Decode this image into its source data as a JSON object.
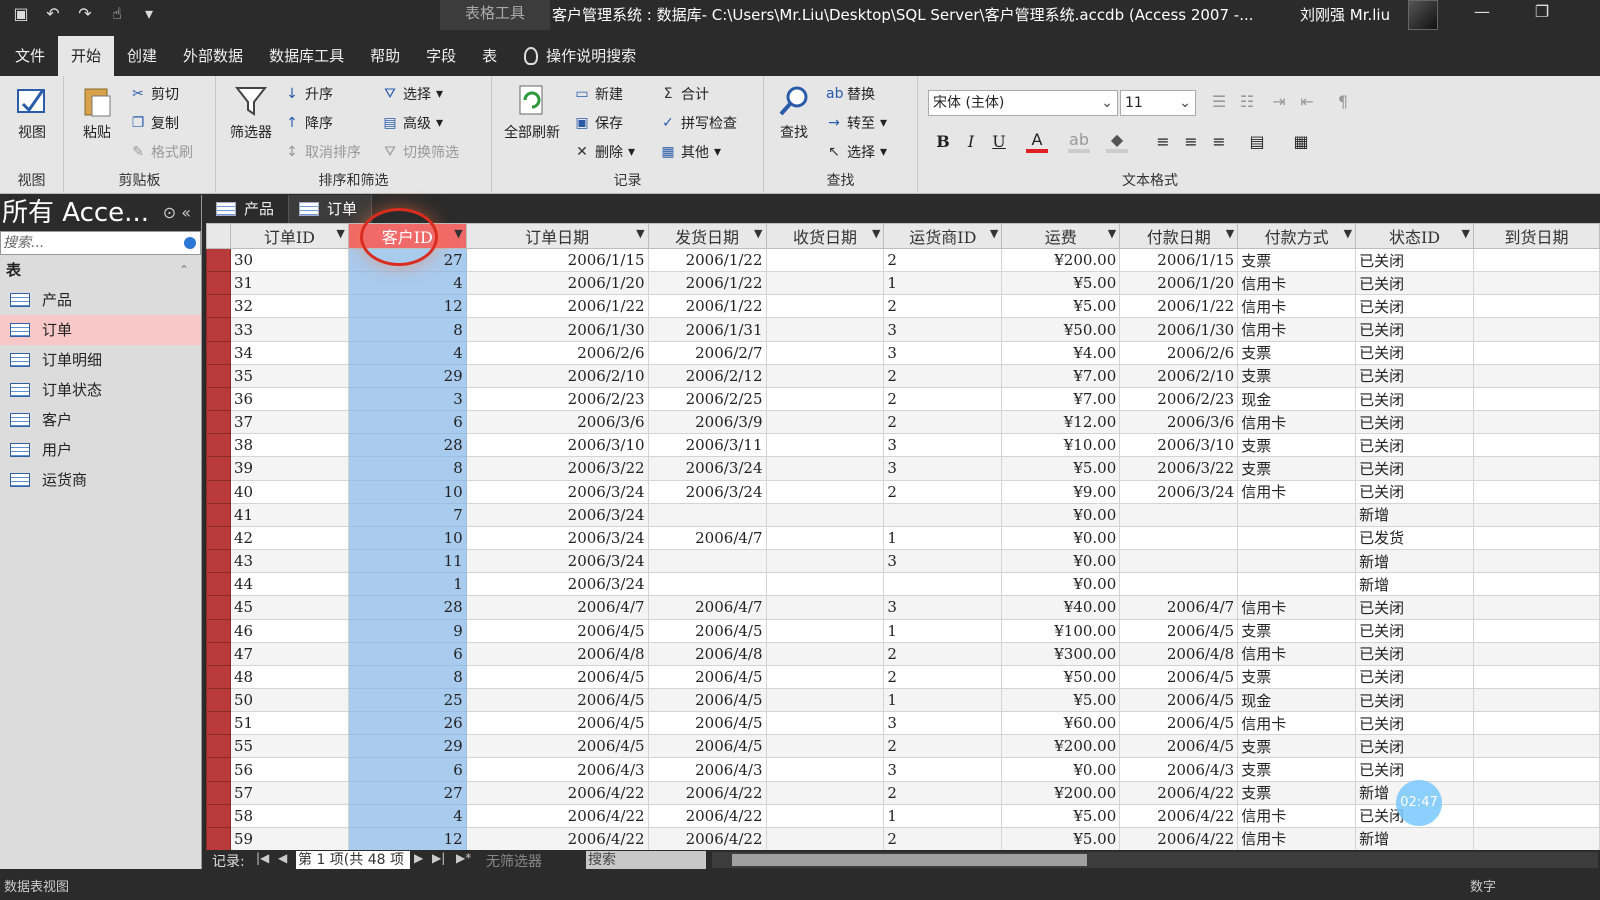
{
  "titlebar": {
    "context_tab": "表格工具",
    "title": "客户管理系统 : 数据库- C:\\Users\\Mr.Liu\\Desktop\\SQL Server\\客户管理系统.accdb (Access 2007 -...",
    "user": "刘刚强 Mr.liu"
  },
  "tabs": [
    "文件",
    "开始",
    "创建",
    "外部数据",
    "数据库工具",
    "帮助",
    "字段",
    "表"
  ],
  "tell_me": "操作说明搜索",
  "ribbon": {
    "view": {
      "label": "视图",
      "group": "视图"
    },
    "clipboard": {
      "paste": "粘贴",
      "cut": "剪切",
      "copy": "复制",
      "format_painter": "格式刷",
      "group": "剪贴板"
    },
    "sort_filter": {
      "filter": "筛选器",
      "asc": "升序",
      "desc": "降序",
      "remove_sort": "取消排序",
      "selection": "选择",
      "advanced": "高级",
      "toggle_filter": "切换筛选",
      "group": "排序和筛选"
    },
    "records": {
      "refresh": "全部刷新",
      "new": "新建",
      "save": "保存",
      "delete": "删除",
      "totals": "合计",
      "spelling": "拼写检查",
      "more": "其他",
      "group": "记录"
    },
    "find": {
      "find": "查找",
      "replace": "替换",
      "goto": "转至",
      "select": "选择",
      "group": "查找"
    },
    "text_format": {
      "font": "宋体 (主体)",
      "size": "11",
      "group": "文本格式"
    }
  },
  "nav": {
    "header": "所有 Acce...",
    "search_placeholder": "搜索...",
    "section": "表",
    "items": [
      "产品",
      "订单",
      "订单明细",
      "订单状态",
      "客户",
      "用户",
      "运货商"
    ],
    "active_index": 1
  },
  "doc_tabs": [
    "产品",
    "订单"
  ],
  "grid": {
    "columns": [
      "订单ID",
      "客户ID",
      "订单日期",
      "发货日期",
      "收货日期",
      "运货商ID",
      "运费",
      "付款日期",
      "付款方式",
      "状态ID",
      "到货日期"
    ],
    "selected_column": 1,
    "rows": [
      [
        "30",
        "27",
        "2006/1/15",
        "2006/1/22",
        "",
        "2",
        "¥200.00",
        "2006/1/15",
        "支票",
        "已关闭",
        ""
      ],
      [
        "31",
        "4",
        "2006/1/20",
        "2006/1/22",
        "",
        "1",
        "¥5.00",
        "2006/1/20",
        "信用卡",
        "已关闭",
        ""
      ],
      [
        "32",
        "12",
        "2006/1/22",
        "2006/1/22",
        "",
        "2",
        "¥5.00",
        "2006/1/22",
        "信用卡",
        "已关闭",
        ""
      ],
      [
        "33",
        "8",
        "2006/1/30",
        "2006/1/31",
        "",
        "3",
        "¥50.00",
        "2006/1/30",
        "信用卡",
        "已关闭",
        ""
      ],
      [
        "34",
        "4",
        "2006/2/6",
        "2006/2/7",
        "",
        "3",
        "¥4.00",
        "2006/2/6",
        "支票",
        "已关闭",
        ""
      ],
      [
        "35",
        "29",
        "2006/2/10",
        "2006/2/12",
        "",
        "2",
        "¥7.00",
        "2006/2/10",
        "支票",
        "已关闭",
        ""
      ],
      [
        "36",
        "3",
        "2006/2/23",
        "2006/2/25",
        "",
        "2",
        "¥7.00",
        "2006/2/23",
        "现金",
        "已关闭",
        ""
      ],
      [
        "37",
        "6",
        "2006/3/6",
        "2006/3/9",
        "",
        "2",
        "¥12.00",
        "2006/3/6",
        "信用卡",
        "已关闭",
        ""
      ],
      [
        "38",
        "28",
        "2006/3/10",
        "2006/3/11",
        "",
        "3",
        "¥10.00",
        "2006/3/10",
        "支票",
        "已关闭",
        ""
      ],
      [
        "39",
        "8",
        "2006/3/22",
        "2006/3/24",
        "",
        "3",
        "¥5.00",
        "2006/3/22",
        "支票",
        "已关闭",
        ""
      ],
      [
        "40",
        "10",
        "2006/3/24",
        "2006/3/24",
        "",
        "2",
        "¥9.00",
        "2006/3/24",
        "信用卡",
        "已关闭",
        ""
      ],
      [
        "41",
        "7",
        "2006/3/24",
        "",
        "",
        "",
        "¥0.00",
        "",
        "",
        "新增",
        ""
      ],
      [
        "42",
        "10",
        "2006/3/24",
        "2006/4/7",
        "",
        "1",
        "¥0.00",
        "",
        "",
        "已发货",
        ""
      ],
      [
        "43",
        "11",
        "2006/3/24",
        "",
        "",
        "3",
        "¥0.00",
        "",
        "",
        "新增",
        ""
      ],
      [
        "44",
        "1",
        "2006/3/24",
        "",
        "",
        "",
        "¥0.00",
        "",
        "",
        "新增",
        ""
      ],
      [
        "45",
        "28",
        "2006/4/7",
        "2006/4/7",
        "",
        "3",
        "¥40.00",
        "2006/4/7",
        "信用卡",
        "已关闭",
        ""
      ],
      [
        "46",
        "9",
        "2006/4/5",
        "2006/4/5",
        "",
        "1",
        "¥100.00",
        "2006/4/5",
        "支票",
        "已关闭",
        ""
      ],
      [
        "47",
        "6",
        "2006/4/8",
        "2006/4/8",
        "",
        "2",
        "¥300.00",
        "2006/4/8",
        "信用卡",
        "已关闭",
        ""
      ],
      [
        "48",
        "8",
        "2006/4/5",
        "2006/4/5",
        "",
        "2",
        "¥50.00",
        "2006/4/5",
        "支票",
        "已关闭",
        ""
      ],
      [
        "50",
        "25",
        "2006/4/5",
        "2006/4/5",
        "",
        "1",
        "¥5.00",
        "2006/4/5",
        "现金",
        "已关闭",
        ""
      ],
      [
        "51",
        "26",
        "2006/4/5",
        "2006/4/5",
        "",
        "3",
        "¥60.00",
        "2006/4/5",
        "信用卡",
        "已关闭",
        ""
      ],
      [
        "55",
        "29",
        "2006/4/5",
        "2006/4/5",
        "",
        "2",
        "¥200.00",
        "2006/4/5",
        "支票",
        "已关闭",
        ""
      ],
      [
        "56",
        "6",
        "2006/4/3",
        "2006/4/3",
        "",
        "3",
        "¥0.00",
        "2006/4/3",
        "支票",
        "已关闭",
        ""
      ],
      [
        "57",
        "27",
        "2006/4/22",
        "2006/4/22",
        "",
        "2",
        "¥200.00",
        "2006/4/22",
        "支票",
        "新增",
        ""
      ],
      [
        "58",
        "4",
        "2006/4/22",
        "2006/4/22",
        "",
        "1",
        "¥5.00",
        "2006/4/22",
        "信用卡",
        "已关闭",
        ""
      ],
      [
        "59",
        "12",
        "2006/4/22",
        "2006/4/22",
        "",
        "2",
        "¥5.00",
        "2006/4/22",
        "信用卡",
        "新增",
        ""
      ]
    ]
  },
  "record_nav": {
    "label": "记录:",
    "position": "第 1 项(共 48 项",
    "no_filter": "无筛选器",
    "search": "搜索"
  },
  "timer": "02:47",
  "status": {
    "left": "数据表视图",
    "right": "数字"
  }
}
